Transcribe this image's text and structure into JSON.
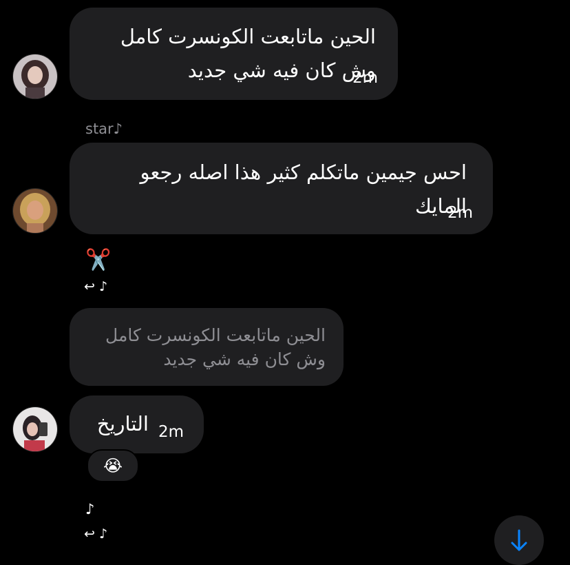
{
  "messages": [
    {
      "line1": "الحين ماتابعت الكونسرت كامل",
      "line2": "وش كان فيه شي جديد",
      "time": "2m"
    },
    {
      "sender": "star♪",
      "line1": "احس جيمين ماتكلم كثير هذا اصله رجعو",
      "line2": "المايك",
      "time": "2m"
    },
    {
      "line1": "التاريخ",
      "time": "2m",
      "reaction": "😭"
    }
  ],
  "reply_indicator": {
    "emoji": "✂️",
    "reply_glyph": "↩ ♪"
  },
  "quoted_message": {
    "line1": "الحين ماتابعت الكونسرت كامل",
    "line2": "وش كان فيه شي جديد"
  },
  "bottom_indicator": {
    "note": "♪",
    "reply_glyph": "↩ ♪"
  },
  "icons": {
    "scroll_down": "arrow-down-icon"
  },
  "colors": {
    "bubble": "#1f1f21",
    "muted_text": "#8e8e93",
    "accent": "#0a84ff"
  }
}
